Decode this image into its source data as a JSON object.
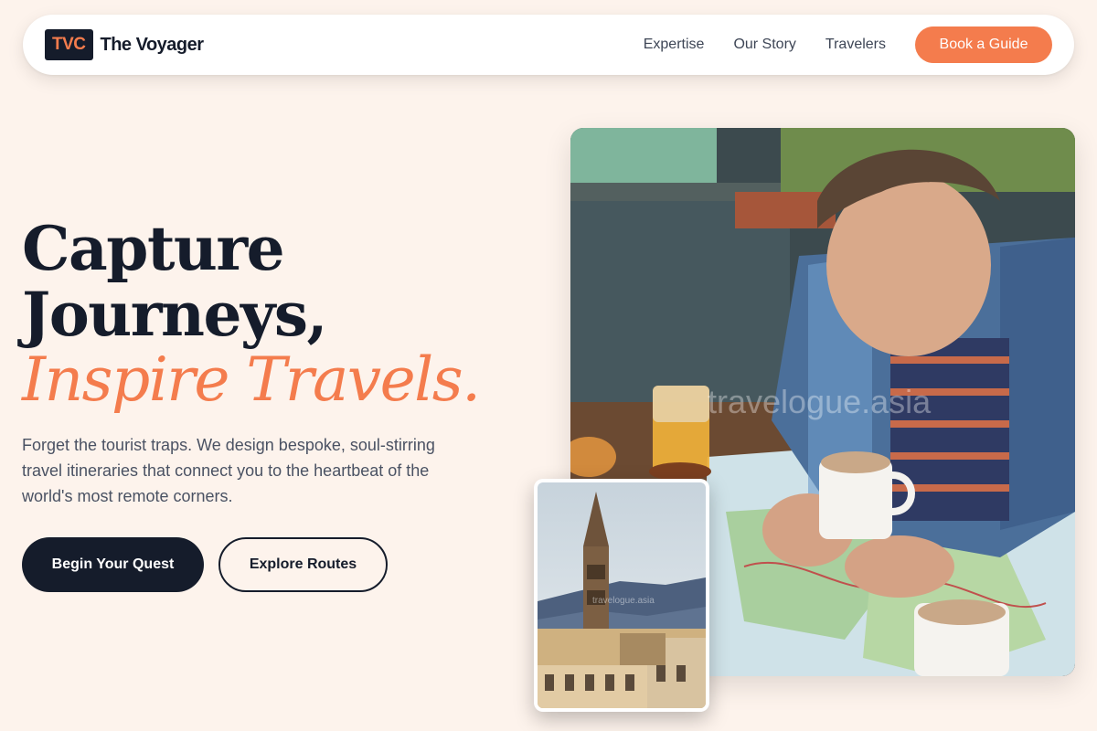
{
  "nav": {
    "logo_badge": "TVC",
    "logo_name": "The Voyager",
    "links": [
      "Expertise",
      "Our Story",
      "Travelers"
    ],
    "cta": "Book a Guide"
  },
  "hero": {
    "title_line1": "Capture",
    "title_line2": "Journeys,",
    "title_accent": "Inspire Travels.",
    "description": "Forget the tourist traps. We design bespoke, soul-stirring travel itineraries that connect you to the heartbeat of the world's most remote corners.",
    "primary_button": "Begin Your Quest",
    "secondary_button": "Explore Routes"
  },
  "images": {
    "main_watermark": "travelogue.asia",
    "inset_watermark": "travelogue.asia"
  },
  "colors": {
    "background": "#fdf3ec",
    "navy": "#151c2b",
    "accent": "#f47c4d"
  }
}
